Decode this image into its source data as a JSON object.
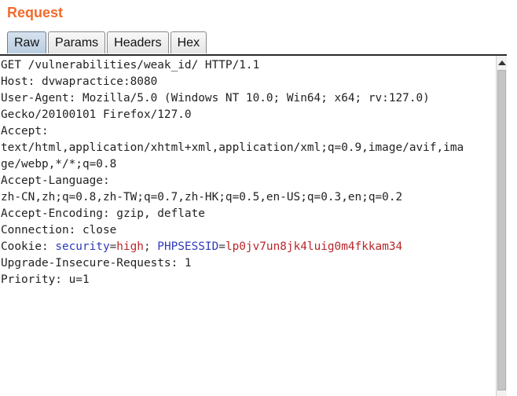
{
  "panel": {
    "title": "Request"
  },
  "tabs": [
    {
      "label": "Raw",
      "active": true
    },
    {
      "label": "Params",
      "active": false
    },
    {
      "label": "Headers",
      "active": false
    },
    {
      "label": "Hex",
      "active": false
    }
  ],
  "request": {
    "lines": [
      "GET /vulnerabilities/weak_id/ HTTP/1.1",
      "Host: dvwapractice:8080",
      "User-Agent: Mozilla/5.0 (Windows NT 10.0; Win64; x64; rv:127.0)",
      "Gecko/20100101 Firefox/127.0",
      "Accept:",
      "text/html,application/xhtml+xml,application/xml;q=0.9,image/avif,ima",
      "ge/webp,*/*;q=0.8",
      "Accept-Language:",
      "zh-CN,zh;q=0.8,zh-TW;q=0.7,zh-HK;q=0.5,en-US;q=0.3,en;q=0.2",
      "Accept-Encoding: gzip, deflate",
      "Connection: close"
    ],
    "cookie": {
      "prefix": "Cookie: ",
      "name1": "security",
      "eq1": "=",
      "value1": "high",
      "sep": "; ",
      "name2": "PHPSESSID",
      "eq2": "=",
      "value2": "lp0jv7un8jk4luig0m4fkkam34"
    },
    "after_cookie": [
      "Upgrade-Insecure-Requests: 1",
      "Priority: u=1"
    ]
  },
  "colors": {
    "title": "#f26b2c",
    "cookie_name": "#2e3ab7",
    "cookie_value": "#b8262b"
  }
}
